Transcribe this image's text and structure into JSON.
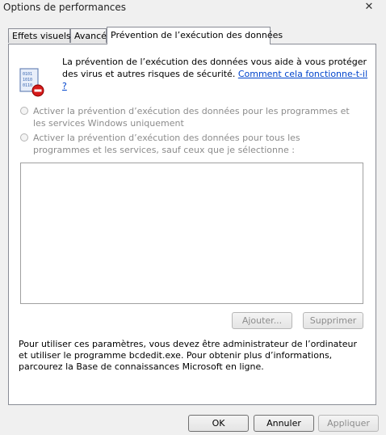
{
  "window": {
    "title": "Options de performances",
    "close_glyph": "✕"
  },
  "tabs": [
    {
      "label": "Effets visuels",
      "active": false
    },
    {
      "label": "Avancé",
      "active": false
    },
    {
      "label": "Prévention de l’exécution des données",
      "active": true
    }
  ],
  "dep": {
    "icon": "dep-shield-icon",
    "description_text": "La prévention de l’exécution des données vous aide à vous protéger des virus et autres risques de sécurité.",
    "link": "Comment cela fonctionne-t-il ?",
    "option1": "Activer la prévention d’exécution des données pour les programmes et les services Windows uniquement",
    "option2": "Activer la prévention d’exécution des données pour tous les programmes et les services, sauf ceux que je sélectionne :",
    "add_button": "Ajouter...",
    "remove_button": "Supprimer",
    "footer": "Pour utiliser ces paramètres, vous devez être administrateur de l’ordinateur et utiliser le programme bcdedit.exe. Pour obtenir plus d’informations, parcourez la Base de connaissances Microsoft en ligne."
  },
  "buttons": {
    "ok": "OK",
    "cancel": "Annuler",
    "apply": "Appliquer"
  }
}
